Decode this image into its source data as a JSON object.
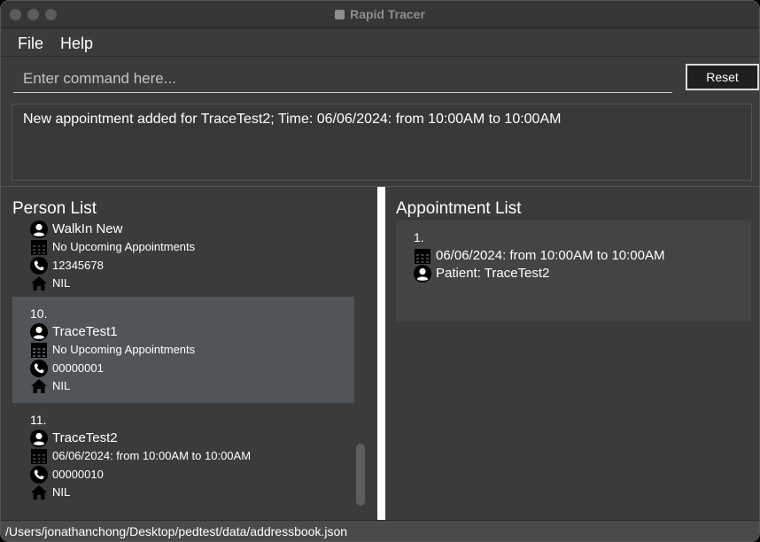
{
  "window": {
    "title": "Rapid Tracer"
  },
  "menu": {
    "file": "File",
    "help": "Help"
  },
  "command": {
    "placeholder": "Enter command here...",
    "value": "",
    "reset_label": "Reset"
  },
  "result": {
    "message": "New appointment added for TraceTest2; Time: 06/06/2024: from 10:00AM to 10:00AM"
  },
  "person_panel": {
    "title": "Person List",
    "persons": [
      {
        "index": "",
        "name": "WalkIn New",
        "appointment": "No Upcoming Appointments",
        "phone": "12345678",
        "address": "NIL",
        "selected": false
      },
      {
        "index": "10.",
        "name": "TraceTest1",
        "appointment": "No Upcoming Appointments",
        "phone": "00000001",
        "address": "NIL",
        "selected": true
      },
      {
        "index": "11.",
        "name": "TraceTest2",
        "appointment": "06/06/2024: from 10:00AM to 10:00AM",
        "phone": "00000010",
        "address": "NIL",
        "selected": false
      }
    ]
  },
  "appointment_panel": {
    "title": "Appointment List",
    "appointments": [
      {
        "index": "1.",
        "time": "06/06/2024: from 10:00AM to 10:00AM",
        "patient": "Patient: TraceTest2"
      }
    ]
  },
  "status": {
    "path": "/Users/jonathanchong/Desktop/pedtest/data/addressbook.json"
  },
  "icons": {
    "person": "person-icon",
    "calendar": "calendar-icon",
    "phone": "phone-icon",
    "home": "home-icon"
  },
  "colors": {
    "background": "#3b3b3b",
    "selected_card": "#4f5558",
    "appointment_card": "#444444",
    "split_bar": "#ffffff"
  }
}
